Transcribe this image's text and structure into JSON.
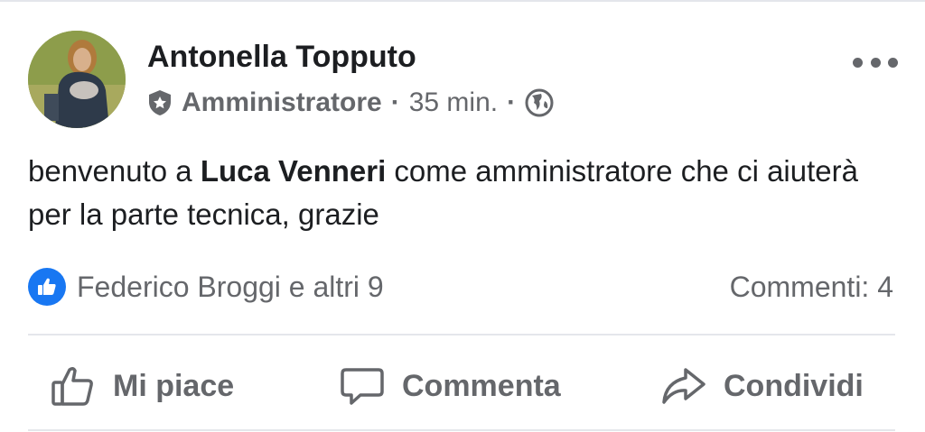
{
  "post": {
    "author": "Antonella Topputo",
    "role": "Amministratore",
    "separator": "·",
    "time": "35 min.",
    "message": {
      "prefix": "benvenuto a ",
      "mention": "Luca Venneri",
      "suffix": " come amministratore che ci aiuterà per la parte tecnica, grazie"
    }
  },
  "stats": {
    "reactions_text": "Federico Broggi e altri 9",
    "comments_text": "Commenti: 4"
  },
  "actions": {
    "like_label": "Mi piace",
    "comment_label": "Commenta",
    "share_label": "Condividi"
  },
  "icons": {
    "admin": "shield-star-icon",
    "audience": "globe-icon",
    "menu": "more-dots-icon",
    "reaction": "like-icon"
  },
  "colors": {
    "accent": "#1877f2",
    "secondary_text": "#65676b",
    "primary_text": "#1c1e21"
  }
}
